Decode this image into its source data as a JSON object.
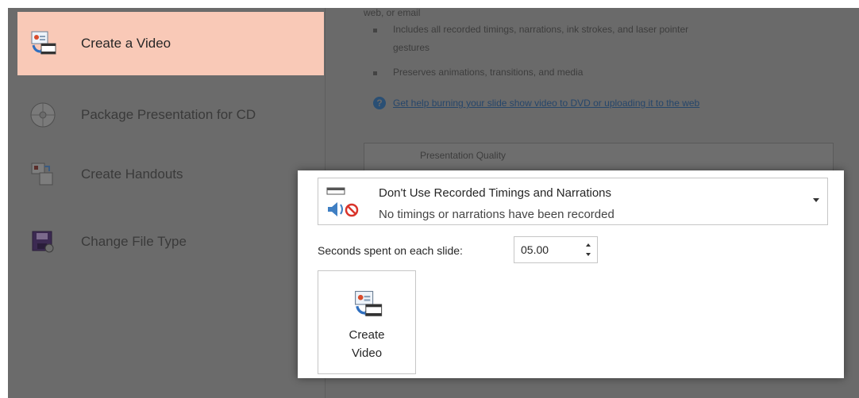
{
  "nav": {
    "items": [
      {
        "label": "Create a Video",
        "icon": "create-video-icon",
        "selected": true
      },
      {
        "label": "Package Presentation for CD",
        "icon": "package-cd-icon",
        "selected": false
      },
      {
        "label": "Create Handouts",
        "icon": "handouts-icon",
        "selected": false
      },
      {
        "label": "Change File Type",
        "icon": "change-file-type-icon",
        "selected": false
      }
    ]
  },
  "background": {
    "top_text": "web, or email",
    "bullets": [
      "Includes all recorded timings, narrations, ink strokes, and laser pointer",
      "gestures",
      "Preserves animations, transitions, and media"
    ],
    "help_link": "Get help burning your slide show video to DVD or uploading it to the web",
    "quality_label": "Presentation Quality"
  },
  "popup": {
    "timings_dropdown": {
      "title": "Don't Use Recorded Timings and Narrations",
      "subtitle": "No timings or narrations have been recorded"
    },
    "seconds_label": "Seconds spent on each slide:",
    "seconds_value": "05.00",
    "create_button": {
      "line1": "Create",
      "line2": "Video"
    }
  },
  "colors": {
    "selected_nav": "#f9c9b7",
    "dim_overlay": "#6a6a6a",
    "no_symbol": "#d9342b",
    "speaker_blue": "#3f7fc3"
  }
}
